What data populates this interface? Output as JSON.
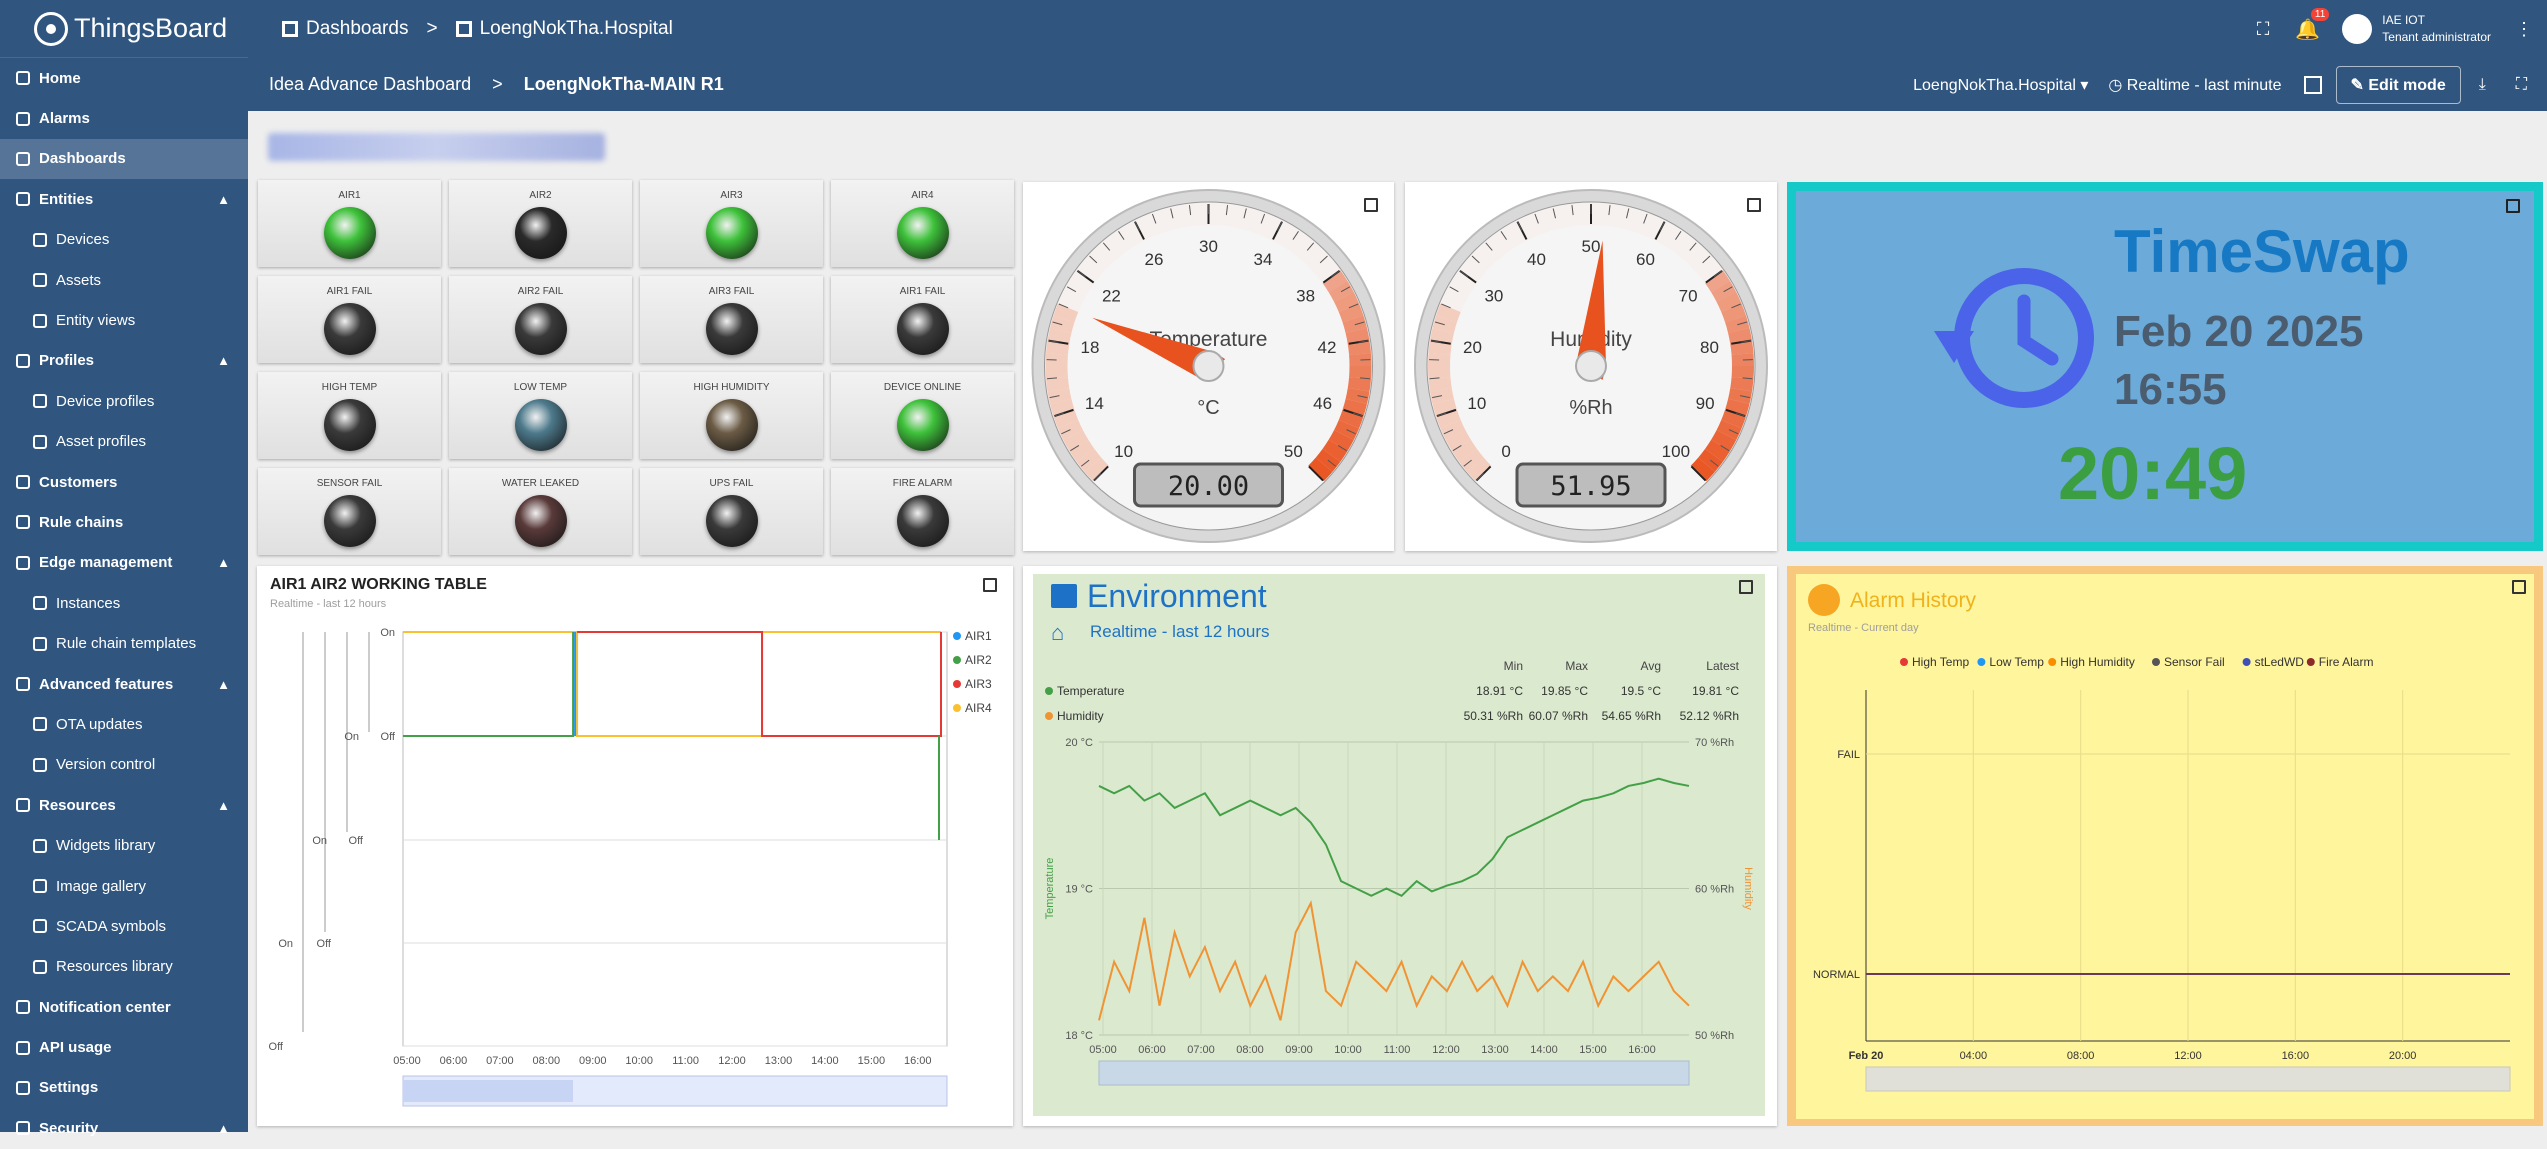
{
  "sidebar": {
    "brand": "ThingsBoard",
    "items": [
      {
        "label": "Home",
        "level": "top",
        "icon": "home-icon"
      },
      {
        "label": "Alarms",
        "level": "top",
        "icon": "alarm-icon"
      },
      {
        "label": "Dashboards",
        "level": "top",
        "icon": "dashboard-icon",
        "selected": true
      },
      {
        "label": "Entities",
        "level": "top",
        "icon": "entities-icon",
        "expand": true
      },
      {
        "label": "Devices",
        "level": "sub",
        "icon": "device-icon"
      },
      {
        "label": "Assets",
        "level": "sub",
        "icon": "asset-icon"
      },
      {
        "label": "Entity views",
        "level": "sub",
        "icon": "entity-view-icon"
      },
      {
        "label": "Profiles",
        "level": "top",
        "icon": "profiles-icon",
        "expand": true
      },
      {
        "label": "Device profiles",
        "level": "sub",
        "icon": "device-profile-icon"
      },
      {
        "label": "Asset profiles",
        "level": "sub",
        "icon": "asset-profile-icon"
      },
      {
        "label": "Customers",
        "level": "top",
        "icon": "customers-icon"
      },
      {
        "label": "Rule chains",
        "level": "top",
        "icon": "rule-chain-icon"
      },
      {
        "label": "Edge management",
        "level": "top",
        "icon": "edge-icon",
        "expand": true
      },
      {
        "label": "Instances",
        "level": "sub",
        "icon": "instance-icon"
      },
      {
        "label": "Rule chain templates",
        "level": "sub",
        "icon": "template-icon"
      },
      {
        "label": "Advanced features",
        "level": "top",
        "icon": "advanced-icon",
        "expand": true
      },
      {
        "label": "OTA updates",
        "level": "sub",
        "icon": "ota-icon"
      },
      {
        "label": "Version control",
        "level": "sub",
        "icon": "version-icon"
      },
      {
        "label": "Resources",
        "level": "top",
        "icon": "resources-icon",
        "expand": true
      },
      {
        "label": "Widgets library",
        "level": "sub",
        "icon": "widgets-icon"
      },
      {
        "label": "Image gallery",
        "level": "sub",
        "icon": "image-icon"
      },
      {
        "label": "SCADA symbols",
        "level": "sub",
        "icon": "scada-icon"
      },
      {
        "label": "Resources library",
        "level": "sub",
        "icon": "library-icon"
      },
      {
        "label": "Notification center",
        "level": "top",
        "icon": "notification-icon"
      },
      {
        "label": "API usage",
        "level": "top",
        "icon": "api-icon"
      },
      {
        "label": "Settings",
        "level": "top",
        "icon": "settings-icon"
      },
      {
        "label": "Security",
        "level": "top",
        "icon": "security-icon",
        "expand": true
      }
    ]
  },
  "topbar": {
    "crumb1": "Dashboards",
    "crumb_sep": ">",
    "crumb2": "LoengNokTha.Hospital",
    "notif_count": "11",
    "user_name": "IAE IOT",
    "user_role": "Tenant administrator"
  },
  "dashbar": {
    "crumb1": "Idea Advance Dashboard",
    "crumb_sep": ">",
    "crumb2": "LoengNokTha-MAIN R1",
    "entity_select": "LoengNokTha.Hospital",
    "timewindow": "Realtime - last minute",
    "edit_label": "Edit mode"
  },
  "leds": [
    {
      "label": "AIR1",
      "color": "#3ec13a"
    },
    {
      "label": "AIR2",
      "color": "#2a2a2a"
    },
    {
      "label": "AIR3",
      "color": "#3ec13a"
    },
    {
      "label": "AIR4",
      "color": "#3ec13a"
    },
    {
      "label": "AIR1 FAIL",
      "color": "#3a3a3a"
    },
    {
      "label": "AIR2 FAIL",
      "color": "#3a3a3a"
    },
    {
      "label": "AIR3 FAIL",
      "color": "#3a3a3a"
    },
    {
      "label": "AIR1 FAIL",
      "color": "#3a3a3a"
    },
    {
      "label": "HIGH TEMP",
      "color": "#3a3a3a"
    },
    {
      "label": "LOW TEMP",
      "color": "#4d7a8c"
    },
    {
      "label": "HIGH HUMIDITY",
      "color": "#6b5b45"
    },
    {
      "label": "DEVICE ONLINE",
      "color": "#3ec13a"
    },
    {
      "label": "SENSOR FAIL",
      "color": "#3a3a3a"
    },
    {
      "label": "WATER LEAKED",
      "color": "#5a3a3a"
    },
    {
      "label": "UPS FAIL",
      "color": "#3a3a3a"
    },
    {
      "label": "FIRE ALARM",
      "color": "#3a3a3a"
    }
  ],
  "gauge_temp": {
    "title": "Temperature",
    "unit": "°C",
    "value": 20.0,
    "display": "20.00",
    "min": 10,
    "max": 50,
    "ticks": [
      "10",
      "14",
      "18",
      "22",
      "26",
      "30",
      "34",
      "38",
      "42",
      "46",
      "50"
    ]
  },
  "gauge_hum": {
    "title": "Humidity",
    "unit": "%Rh",
    "value": 51.95,
    "display": "51.95",
    "min": 0,
    "max": 100,
    "ticks": [
      "0",
      "10",
      "20",
      "30",
      "40",
      "50",
      "60",
      "70",
      "80",
      "90",
      "100"
    ]
  },
  "timeswap": {
    "title": "TimeSwap",
    "date": "Feb 20 2025",
    "time_small": "16:55",
    "time_big": "20:49"
  },
  "working_table": {
    "title": "AIR1 AIR2 WORKING TABLE",
    "subtitle": "Realtime - last 12 hours",
    "legend": [
      {
        "name": "AIR1",
        "color": "#2196f3"
      },
      {
        "name": "AIR2",
        "color": "#43a047"
      },
      {
        "name": "AIR3",
        "color": "#e53935"
      },
      {
        "name": "AIR4",
        "color": "#fbc02d"
      }
    ],
    "ylabels": [
      "On",
      "On",
      "Off",
      "On",
      "Off",
      "On",
      "Off",
      "Off"
    ],
    "xticks": [
      "05:00",
      "06:00",
      "07:00",
      "08:00",
      "09:00",
      "10:00",
      "11:00",
      "12:00",
      "13:00",
      "14:00",
      "15:00",
      "16:00"
    ]
  },
  "environment": {
    "title": "Environment",
    "subtitle": "Realtime - last 12 hours",
    "cols": [
      "Min",
      "Max",
      "Avg",
      "Latest"
    ],
    "rows": [
      {
        "name": "Temperature",
        "color": "#43a047",
        "vals": [
          "18.91 °C",
          "19.85 °C",
          "19.5 °C",
          "19.81 °C"
        ]
      },
      {
        "name": "Humidity",
        "color": "#f09433",
        "vals": [
          "50.31 %Rh",
          "60.07 %Rh",
          "54.65 %Rh",
          "52.12 %Rh"
        ]
      }
    ],
    "y_left": [
      "20 °C",
      "19 °C",
      "18 °C"
    ],
    "y_right": [
      "70 %Rh",
      "60 %Rh",
      "50 %Rh"
    ],
    "y_left_label": "Temperature",
    "y_right_label": "Humidity",
    "xticks": [
      "05:00",
      "06:00",
      "07:00",
      "08:00",
      "09:00",
      "10:00",
      "11:00",
      "12:00",
      "13:00",
      "14:00",
      "15:00",
      "16:00"
    ]
  },
  "alarm_history": {
    "title": "Alarm History",
    "subtitle": "Realtime - Current day",
    "legend": [
      {
        "name": "High Temp",
        "color": "#e53935"
      },
      {
        "name": "Low Temp",
        "color": "#2196f3"
      },
      {
        "name": "High Humidity",
        "color": "#fb8c00"
      },
      {
        "name": "Sensor Fail",
        "color": "#555555"
      },
      {
        "name": "stLedWD",
        "color": "#3f51b5"
      },
      {
        "name": "Fire Alarm",
        "color": "#8d2a2a"
      }
    ],
    "ylabels": [
      "FAIL",
      "NORMAL"
    ],
    "xticks": [
      "Feb 20",
      "04:00",
      "08:00",
      "12:00",
      "16:00",
      "20:00"
    ]
  }
}
